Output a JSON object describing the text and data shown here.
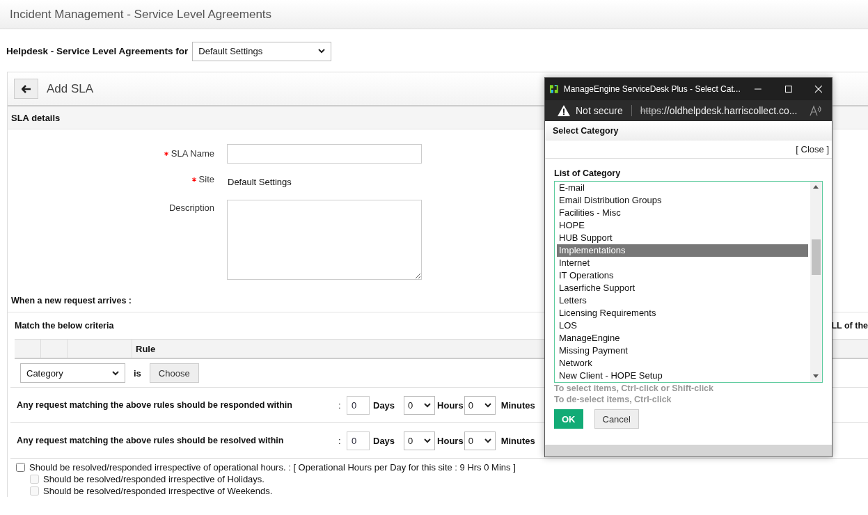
{
  "page_title": "Incident Management - Service Level Agreements",
  "site_selector": {
    "label": "Helpdesk - Service Level Agreements for",
    "value": "Default Settings"
  },
  "panel": {
    "title": "Add SLA",
    "section": "SLA details",
    "fields": [
      {
        "kind": "input",
        "label": "SLA Name",
        "required": true
      },
      {
        "kind": "text",
        "label": "Site",
        "required": true,
        "value": "Default Settings"
      },
      {
        "kind": "textarea",
        "label": "Description",
        "required": false
      }
    ],
    "arrival_heading": "When a new request arrives :",
    "criteria_heading": "Match the below criteria",
    "criteria_right": "LL of the",
    "rule_header": "Rule",
    "rule": {
      "field": "Category",
      "operator": "is",
      "button": "Choose"
    },
    "times": [
      {
        "label": "Any request matching the above rules should be responded within",
        "separator": ":",
        "days": "0",
        "days_label": "Days",
        "hours": "0",
        "hours_label": "Hours",
        "minutes": "0",
        "minutes_label": "Minutes"
      },
      {
        "label": "Any request matching the above rules should be resolved within",
        "separator": ":",
        "days": "0",
        "days_label": "Days",
        "hours": "0",
        "hours_label": "Hours",
        "minutes": "0",
        "minutes_label": "Minutes"
      }
    ],
    "options": [
      {
        "label": "Should be resolved/responded irrespective of operational hours. : [ Operational Hours per Day for this site :  9 Hrs 0 Mins ]",
        "checked": false,
        "disabled": false,
        "children": [
          {
            "label": "Should be resolved/responded irrespective of Holidays.",
            "checked": false,
            "disabled": true
          },
          {
            "label": "Should be resolved/responded irrespective of Weekends.",
            "checked": false,
            "disabled": true
          }
        ]
      }
    ]
  },
  "popup": {
    "title": "ManageEngine ServiceDesk Plus - Select Cat...",
    "security": "Not secure",
    "url_scheme": "https",
    "url_rest": "://oldhelpdesk.harriscollect.co...",
    "heading": "Select Category",
    "close": "[ Close ]",
    "list_label": "List of Category",
    "items": [
      {
        "label": "E-mail",
        "selected": false
      },
      {
        "label": "Email Distribution Groups",
        "selected": false
      },
      {
        "label": "Facilities - Misc",
        "selected": false
      },
      {
        "label": "HOPE",
        "selected": false
      },
      {
        "label": "HUB Support",
        "selected": false
      },
      {
        "label": "Implementations",
        "selected": true
      },
      {
        "label": "Internet",
        "selected": false
      },
      {
        "label": "IT Operations",
        "selected": false
      },
      {
        "label": "Laserfiche Support",
        "selected": false
      },
      {
        "label": "Letters",
        "selected": false
      },
      {
        "label": "Licensing Requirements",
        "selected": false
      },
      {
        "label": "LOS",
        "selected": false
      },
      {
        "label": "ManageEngine",
        "selected": false
      },
      {
        "label": "Missing Payment",
        "selected": false
      },
      {
        "label": "Network",
        "selected": false
      },
      {
        "label": "New Client - HOPE Setup",
        "selected": false
      }
    ],
    "hints": [
      "To select items, Ctrl-click or Shift-click",
      "To de-select items, Ctrl-click"
    ],
    "buttons": [
      {
        "label": "OK",
        "kind": "primary"
      },
      {
        "label": "Cancel",
        "kind": "secondary"
      }
    ]
  }
}
